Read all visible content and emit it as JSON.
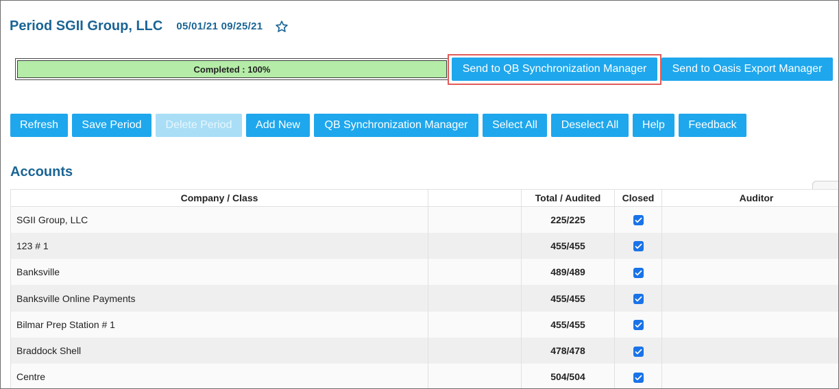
{
  "header": {
    "title": "Period SGII Group, LLC",
    "dates": "05/01/21 09/25/21",
    "favorite_icon": "star-outline-icon"
  },
  "progress": {
    "label": "Completed : 100%",
    "percent": 100
  },
  "export_buttons": {
    "send_qb": "Send to QB Synchronization Manager",
    "send_oasis": "Send to Oasis Export Manager"
  },
  "toolbar": {
    "refresh": "Refresh",
    "save_period": "Save Period",
    "delete_period": "Delete Period",
    "add_new": "Add New",
    "qb_sync": "QB Synchronization Manager",
    "select_all": "Select All",
    "deselect_all": "Deselect All",
    "help": "Help",
    "feedback": "Feedback"
  },
  "accounts": {
    "title": "Accounts",
    "columns": {
      "company": "Company / Class",
      "total": "Total / Audited",
      "closed": "Closed",
      "auditor": "Auditor"
    },
    "rows": [
      {
        "company": "SGII Group, LLC",
        "total": "225/225",
        "closed": true,
        "auditor": ""
      },
      {
        "company": "123 # 1",
        "total": "455/455",
        "closed": true,
        "auditor": ""
      },
      {
        "company": "Banksville",
        "total": "489/489",
        "closed": true,
        "auditor": ""
      },
      {
        "company": "Banksville Online Payments",
        "total": "455/455",
        "closed": true,
        "auditor": ""
      },
      {
        "company": "Bilmar Prep Station # 1",
        "total": "455/455",
        "closed": true,
        "auditor": ""
      },
      {
        "company": "Braddock Shell",
        "total": "478/478",
        "closed": true,
        "auditor": ""
      },
      {
        "company": "Centre",
        "total": "504/504",
        "closed": true,
        "auditor": ""
      }
    ]
  },
  "colors": {
    "title": "#1a6494",
    "button": "#1ea7ec",
    "progress_fill": "#b5eca8",
    "highlight": "#e25a57",
    "checkbox": "#1a73e8"
  }
}
